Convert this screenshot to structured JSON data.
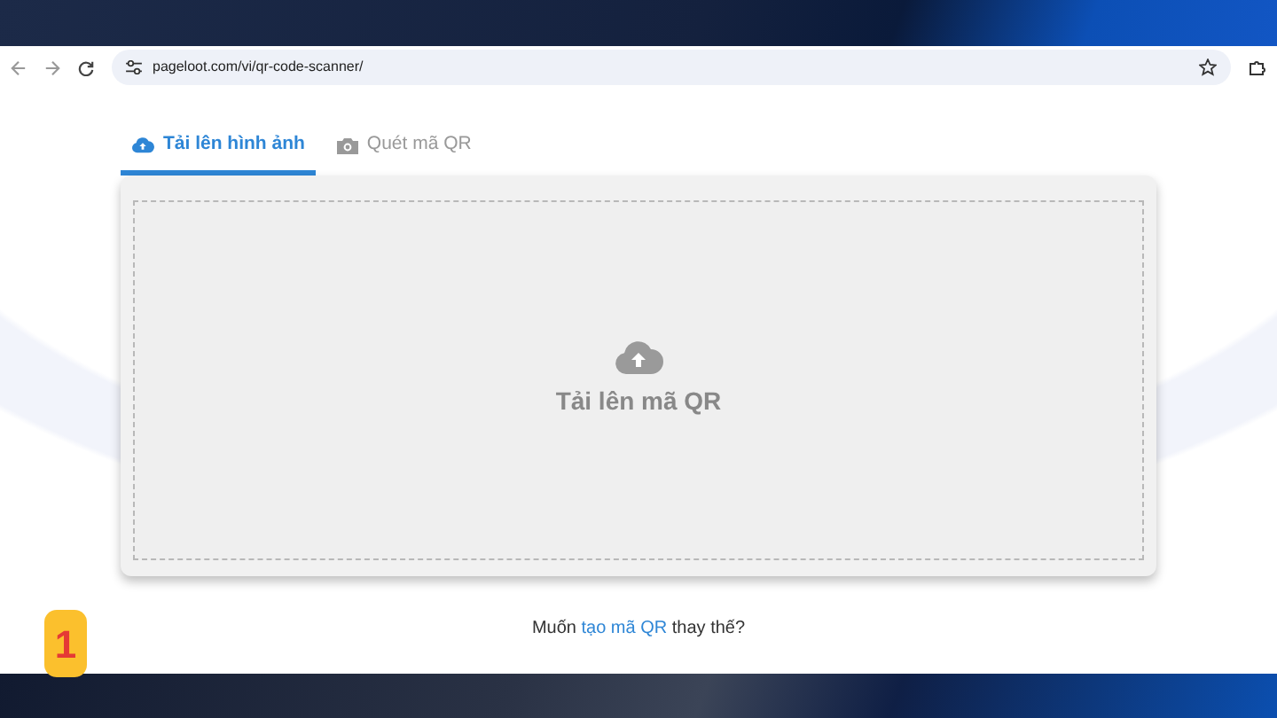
{
  "browser": {
    "url": "pageloot.com/vi/qr-code-scanner/"
  },
  "tabs": [
    {
      "label": "Tải lên hình ảnh",
      "selected": true
    },
    {
      "label": "Quét mã QR",
      "selected": false
    }
  ],
  "dropzone": {
    "label": "Tải lên mã QR"
  },
  "footer": {
    "before": "Muốn",
    "link": "tạo mã QR",
    "after": "thay thế?"
  },
  "step_badge": "1"
}
